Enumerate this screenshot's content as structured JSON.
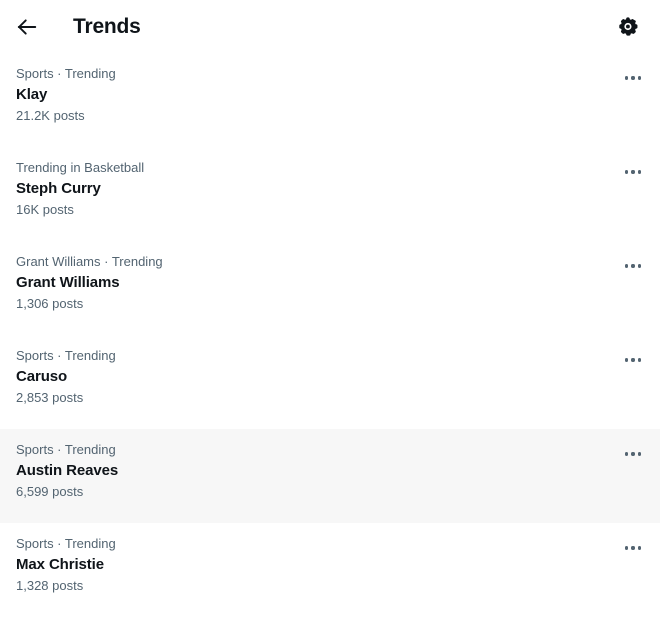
{
  "header": {
    "back_icon": "arrow-left-icon",
    "title": "Trends",
    "settings_icon": "gear-icon"
  },
  "list": {
    "more_icon": "more-horizontal-icon",
    "items": [
      {
        "category": "Sports · Trending",
        "name": "Klay",
        "posts": "21.2K posts",
        "hovered": false
      },
      {
        "category": "Trending in Basketball",
        "name": "Steph Curry",
        "posts": "16K posts",
        "hovered": false
      },
      {
        "category": "Grant Williams · Trending",
        "name": "Grant Williams",
        "posts": "1,306 posts",
        "hovered": false
      },
      {
        "category": "Sports · Trending",
        "name": "Caruso",
        "posts": "2,853 posts",
        "hovered": false
      },
      {
        "category": "Sports · Trending",
        "name": "Austin Reaves",
        "posts": "6,599 posts",
        "hovered": true
      },
      {
        "category": "Sports · Trending",
        "name": "Max Christie",
        "posts": "1,328 posts",
        "hovered": false
      }
    ]
  },
  "colors": {
    "background": "#ffffff",
    "text_primary": "#0f1419",
    "text_secondary": "#536471",
    "row_hover": "#f7f7f7"
  }
}
